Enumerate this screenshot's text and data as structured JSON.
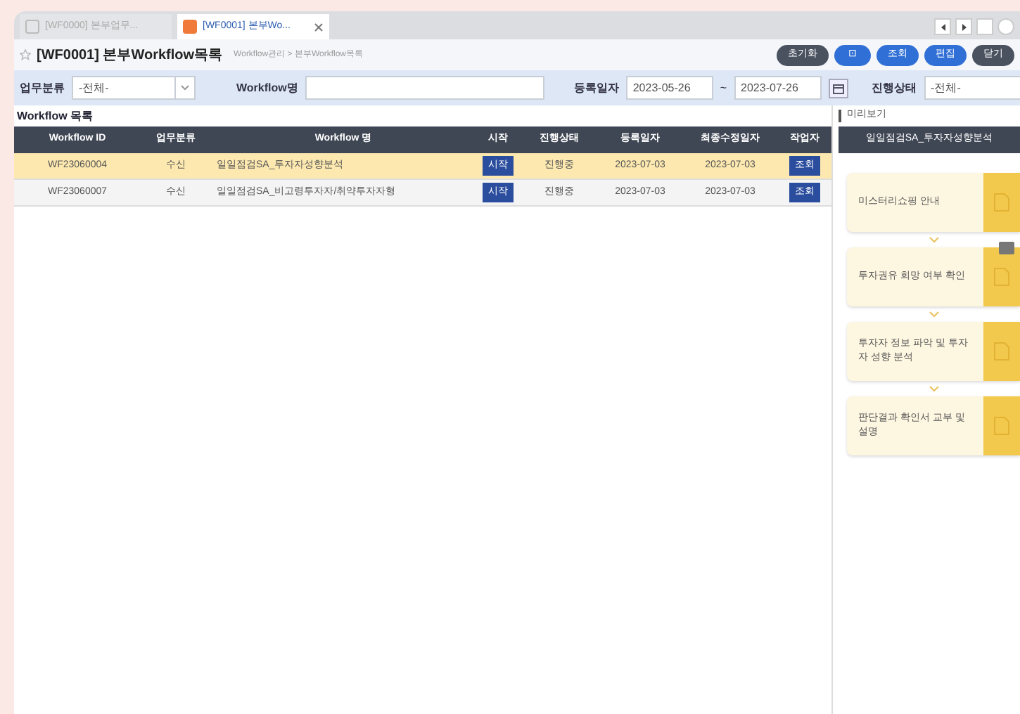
{
  "tabs": [
    {
      "label": "[WF0000] 본부업무...",
      "selected": false
    },
    {
      "label": "[WF0001] 본부Wo...",
      "selected": true
    }
  ],
  "header": {
    "title": "[WF0001] 본부Workflow목록",
    "breadcrumb": "Workflow관리 > 본부Workflow목록",
    "buttons": [
      {
        "label": "초기화",
        "kind": "dark"
      },
      {
        "label": "⊡",
        "kind": "blue"
      },
      {
        "label": "조회",
        "kind": "blue"
      },
      {
        "label": "편집",
        "kind": "blue"
      },
      {
        "label": "닫기",
        "kind": "dark"
      }
    ]
  },
  "filters": {
    "category_label": "업무분류",
    "category_value": "-전체-",
    "name_label": "Workflow명",
    "date_label": "등록일자",
    "date_from": "2023-05-26",
    "date_sep": "~",
    "date_to": "2023-07-26",
    "status_label": "진행상태",
    "status_value": "-전체-"
  },
  "list": {
    "title": "Workflow 목록",
    "columns": [
      "Workflow ID",
      "업무분류",
      "Workflow 명",
      "시작",
      "진행상태",
      "등록일자",
      "최종수정일자",
      "작업자"
    ],
    "rows": [
      {
        "id": "WF23060004",
        "category": "수신",
        "name": "일일점검SA_투자자성향분석",
        "start": "시작",
        "status": "진행중",
        "created": "2023-07-03",
        "modified": "2023-07-03",
        "action": "조회",
        "selected": true
      },
      {
        "id": "WF23060007",
        "category": "수신",
        "name": "일일점검SA_비고령투자자/취약투자자형",
        "start": "시작",
        "status": "진행중",
        "created": "2023-07-03",
        "modified": "2023-07-03",
        "action": "조회",
        "selected": false
      }
    ]
  },
  "preview": {
    "title": "미리보기",
    "header": "일일점검SA_투자자성향분석",
    "steps": [
      {
        "label": "미스터리쇼핑 안내",
        "badge": false
      },
      {
        "label": "투자권유 희망 여부 확인",
        "badge": true
      },
      {
        "label": "투자자 정보 파악 및 투자자 성향 분석",
        "badge": false
      },
      {
        "label": "판단결과 확인서 교부 및 설명",
        "badge": false
      }
    ]
  }
}
